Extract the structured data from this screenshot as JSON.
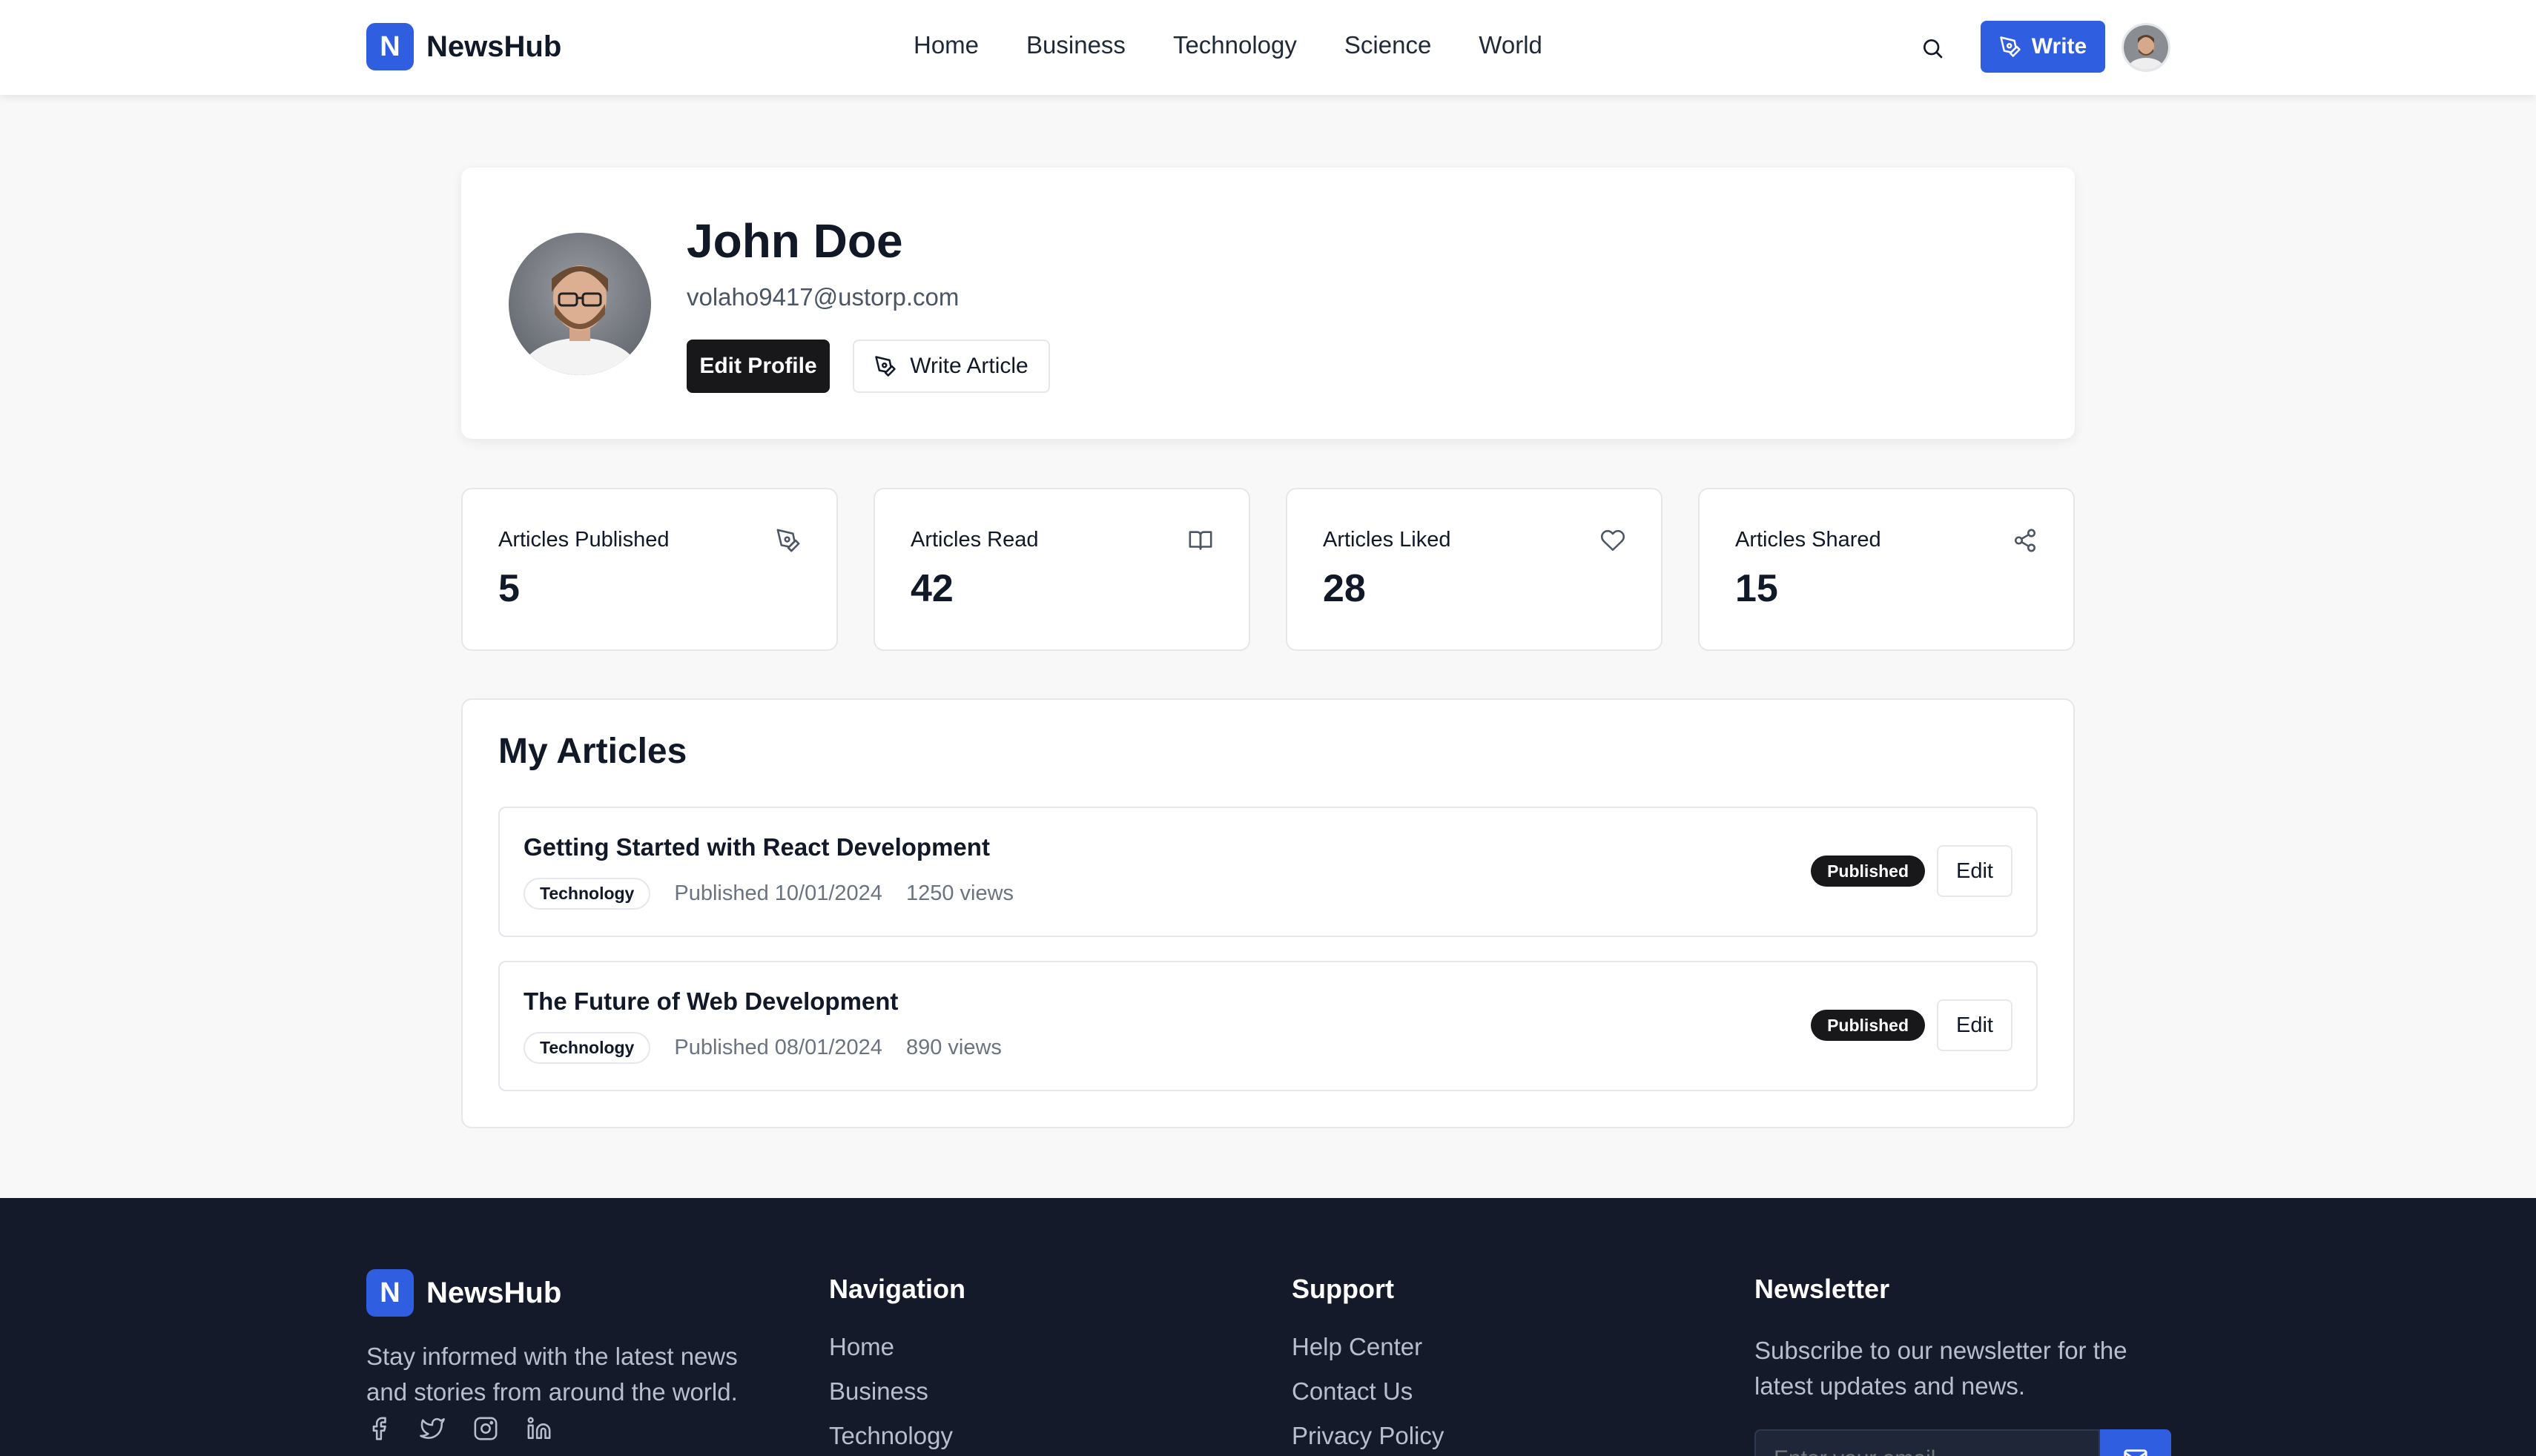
{
  "brand": {
    "letter": "N",
    "name": "NewsHub",
    "accent": "#2f5fe0"
  },
  "nav": [
    "Home",
    "Business",
    "Technology",
    "Science",
    "World"
  ],
  "header": {
    "search_icon": "search-icon",
    "write_label": "Write"
  },
  "profile": {
    "name": "John Doe",
    "email": "volaho9417@ustorp.com",
    "edit_label": "Edit Profile",
    "write_label": "Write Article"
  },
  "stats": [
    {
      "label": "Articles Published",
      "value": "5",
      "icon": "pen-icon"
    },
    {
      "label": "Articles Read",
      "value": "42",
      "icon": "book-icon"
    },
    {
      "label": "Articles Liked",
      "value": "28",
      "icon": "heart-icon"
    },
    {
      "label": "Articles Shared",
      "value": "15",
      "icon": "share-icon"
    }
  ],
  "articles": {
    "title": "My Articles",
    "items": [
      {
        "title": "Getting Started with React Development",
        "category": "Technology",
        "published": "Published 10/01/2024",
        "views": "1250 views",
        "status": "Published",
        "edit_label": "Edit"
      },
      {
        "title": "The Future of Web Development",
        "category": "Technology",
        "published": "Published 08/01/2024",
        "views": "890 views",
        "status": "Published",
        "edit_label": "Edit"
      }
    ]
  },
  "footer": {
    "description": "Stay informed with the latest news and stories from around the world.",
    "socials": [
      "facebook-icon",
      "twitter-icon",
      "instagram-icon",
      "linkedin-icon"
    ],
    "navigation": {
      "title": "Navigation",
      "links": [
        "Home",
        "Business",
        "Technology"
      ]
    },
    "support": {
      "title": "Support",
      "links": [
        "Help Center",
        "Contact Us",
        "Privacy Policy"
      ]
    },
    "newsletter": {
      "title": "Newsletter",
      "text": "Subscribe to our newsletter for the latest updates and news.",
      "placeholder": "Enter your email"
    }
  }
}
